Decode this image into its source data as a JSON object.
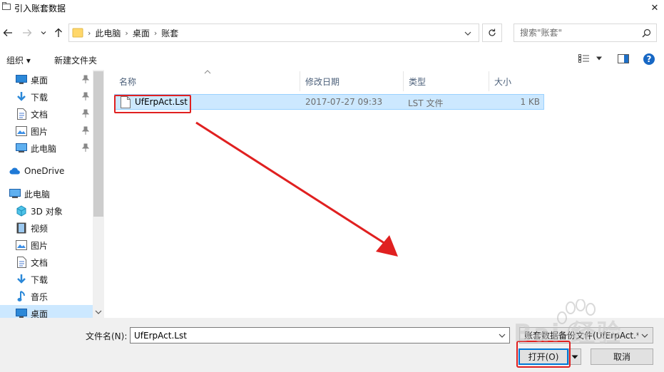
{
  "window": {
    "title": "引入账套数据",
    "close_glyph": "✕"
  },
  "address": {
    "crumbs": [
      "此电脑",
      "桌面",
      "账套"
    ],
    "search_placeholder": "搜索\"账套\""
  },
  "toolbar": {
    "organize_label": "组织 ▾",
    "new_folder_label": "新建文件夹"
  },
  "nav": {
    "items": [
      {
        "label": "桌面",
        "icon": "desktop-icon",
        "pinned": true
      },
      {
        "label": "下载",
        "icon": "download-icon",
        "pinned": true
      },
      {
        "label": "文档",
        "icon": "document-icon",
        "pinned": true
      },
      {
        "label": "图片",
        "icon": "pictures-icon",
        "pinned": true
      },
      {
        "label": "此电脑",
        "icon": "computer-icon",
        "pinned": true
      },
      {
        "label": "OneDrive",
        "icon": "cloud-icon",
        "pinned": false
      },
      {
        "label": "此电脑",
        "icon": "computer-icon",
        "pinned": false
      },
      {
        "label": "3D 对象",
        "icon": "cube-icon",
        "pinned": false
      },
      {
        "label": "视频",
        "icon": "video-icon",
        "pinned": false
      },
      {
        "label": "图片",
        "icon": "pictures-icon",
        "pinned": false
      },
      {
        "label": "文档",
        "icon": "document-icon",
        "pinned": false
      },
      {
        "label": "下载",
        "icon": "download-icon",
        "pinned": false
      },
      {
        "label": "音乐",
        "icon": "music-icon",
        "pinned": false
      },
      {
        "label": "桌面",
        "icon": "desktop-icon",
        "pinned": false
      }
    ]
  },
  "file_list": {
    "columns": [
      "名称",
      "修改日期",
      "类型",
      "大小"
    ],
    "rows": [
      {
        "name": "UfErpAct.Lst",
        "modified": "2017-07-27 09:33",
        "type": "LST 文件",
        "size": "1 KB"
      }
    ]
  },
  "bottom": {
    "filename_label": "文件名(N):",
    "filename_value": "UfErpAct.Lst",
    "filetype_value": "账套数据备份文件(UfErpAct.*)",
    "open_label": "打开(O)",
    "cancel_label": "取消"
  },
  "watermark": {
    "text": "Bai 经验"
  },
  "colors": {
    "selection_bg": "#cce8ff",
    "selection_border": "#99d1ff",
    "annotation_red": "#e02020",
    "accent_blue": "#0078d7"
  }
}
